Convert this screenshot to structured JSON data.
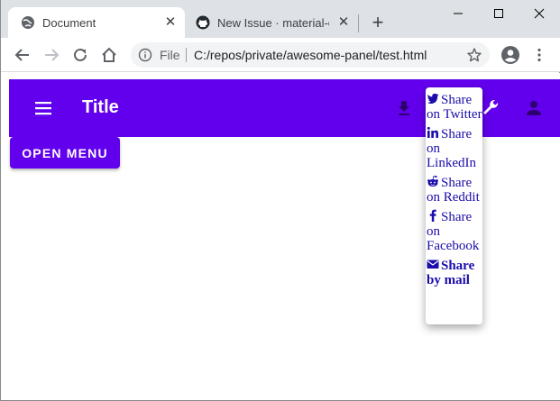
{
  "browser": {
    "tabs": [
      {
        "title": "Document",
        "icon": "globe-icon",
        "active": true
      },
      {
        "title": "New Issue · material-cor",
        "icon": "github-icon",
        "active": false
      }
    ],
    "close_glyph": "✕",
    "new_tab_glyph": "+",
    "address": {
      "scheme_label": "File",
      "url": "C:/repos/private/awesome-panel/test.html"
    }
  },
  "app": {
    "title": "Title",
    "open_menu_label": "OPEN MENU",
    "share_items": [
      {
        "label": "Share on Twitter",
        "icon": "twitter-icon"
      },
      {
        "label": "Share on LinkedIn",
        "icon": "linkedin-icon"
      },
      {
        "label": "Share on Reddit",
        "icon": "reddit-icon"
      },
      {
        "label": "Share on Facebook",
        "icon": "facebook-icon"
      },
      {
        "label": "Share by mail",
        "icon": "mail-icon"
      }
    ],
    "colors": {
      "primary": "#6200ee",
      "link": "#1a0dab"
    }
  }
}
